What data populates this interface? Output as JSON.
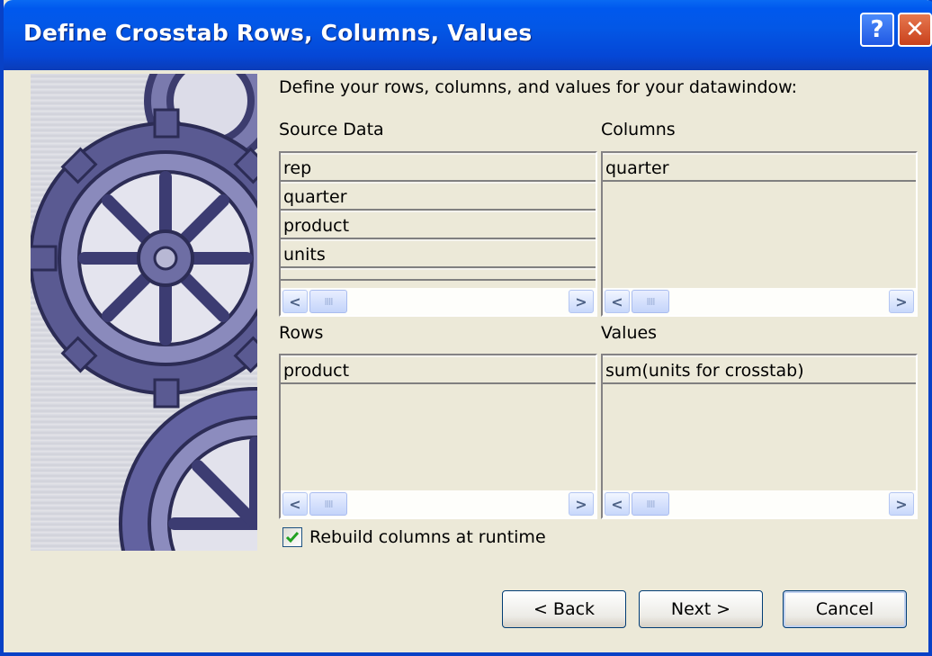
{
  "window": {
    "title": "Define Crosstab Rows, Columns, Values",
    "help_label": "?",
    "close_label": "✕"
  },
  "intro_text": "Define your rows, columns, and values for your datawindow:",
  "source_data": {
    "label": "Source Data",
    "items": [
      "rep",
      "quarter",
      "product",
      "units"
    ]
  },
  "columns": {
    "label": "Columns",
    "items": [
      "quarter"
    ]
  },
  "rows": {
    "label": "Rows",
    "items": [
      "product"
    ]
  },
  "values": {
    "label": "Values",
    "items": [
      "sum(units for crosstab)"
    ]
  },
  "scrollbar": {
    "left_arrow": "<",
    "right_arrow": ">",
    "thumb_grip": "IIII"
  },
  "rebuild": {
    "label": "Rebuild columns at runtime",
    "checked": true
  },
  "buttons": {
    "back": "< Back",
    "next": "Next >",
    "cancel": "Cancel"
  },
  "colors": {
    "titlebar": "#0054e3",
    "dialog_bg": "#ece9d8",
    "check": "#21a121",
    "gear": "#4e4e8a"
  }
}
